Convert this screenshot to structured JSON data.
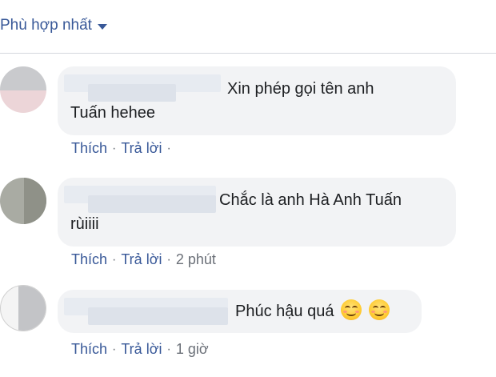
{
  "sort": {
    "label": "Phù hợp nhất",
    "icon": "caret-down-icon"
  },
  "comments": [
    {
      "text_lines": [
        "Xin phép gọi tên anh",
        "Tuấn hehee"
      ],
      "actions": {
        "like": "Thích",
        "reply": "Trả lời",
        "time": ""
      }
    },
    {
      "text_lines": [
        "Chắc là anh Hà Anh Tuấn",
        "rùiiii"
      ],
      "actions": {
        "like": "Thích",
        "reply": "Trả lời",
        "time": "2 phút"
      }
    },
    {
      "text_lines": [
        "Phúc hậu quá"
      ],
      "emojis": [
        "smiling-blush-emoji",
        "smiling-blush-emoji"
      ],
      "actions": {
        "like": "Thích",
        "reply": "Trả lời",
        "time": "1 giờ"
      }
    }
  ],
  "colors": {
    "link": "#385898",
    "bubble": "#f2f3f5",
    "meta": "#6b7078",
    "divider": "#d5d8de"
  }
}
